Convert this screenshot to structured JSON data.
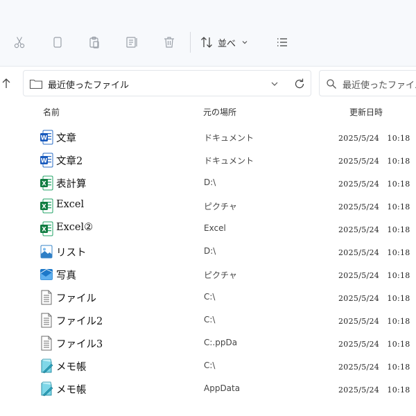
{
  "toolbar": {
    "sort_label": "並べ",
    "buttons": [
      "scissors-icon",
      "copy-icon",
      "paste-icon",
      "rename-icon",
      "trash-icon"
    ]
  },
  "address": {
    "path": "最近使ったファイル",
    "search_placeholder": "最近使ったファイル"
  },
  "columns": {
    "name": "名前",
    "location": "元の場所",
    "date": "更新日時"
  },
  "files": [
    {
      "name": "文章",
      "location": "ドキュメント",
      "date": "2025/5/24　10:18",
      "icon": "word-icon"
    },
    {
      "name": "文章2",
      "location": "ドキュメント",
      "date": "2025/5/24　10:18",
      "icon": "word-icon"
    },
    {
      "name": "表計算",
      "location": "D:\\",
      "date": "2025/5/24　10:18",
      "icon": "excel-icon"
    },
    {
      "name": "Excel",
      "location": "ピクチャ",
      "date": "2025/5/24　10:18",
      "icon": "excel-icon"
    },
    {
      "name": "Excel②",
      "location": "Excel",
      "date": "2025/5/24　10:18",
      "icon": "excel-icon"
    },
    {
      "name": "リスト",
      "location": "D:\\",
      "date": "2025/5/24　10:18",
      "icon": "image-icon"
    },
    {
      "name": "写真",
      "location": "ピクチャ",
      "date": "2025/5/24　10:18",
      "icon": "photo-icon"
    },
    {
      "name": "ファイル",
      "location": "C:\\",
      "date": "2025/5/24　10:18",
      "icon": "text-file-icon"
    },
    {
      "name": "ファイル2",
      "location": "C:\\",
      "date": "2025/5/24　10:18",
      "icon": "text-file-icon"
    },
    {
      "name": "ファイル3",
      "location": "C:.ppDa",
      "date": "2025/5/24　10:18",
      "icon": "text-file-icon"
    },
    {
      "name": "メモ帳",
      "location": "C:\\",
      "date": "2025/5/24　10:18",
      "icon": "notepad-icon"
    },
    {
      "name": "メモ帳",
      "location": "AppData",
      "date": "2025/5/24　10:18",
      "icon": "notepad-icon"
    }
  ]
}
